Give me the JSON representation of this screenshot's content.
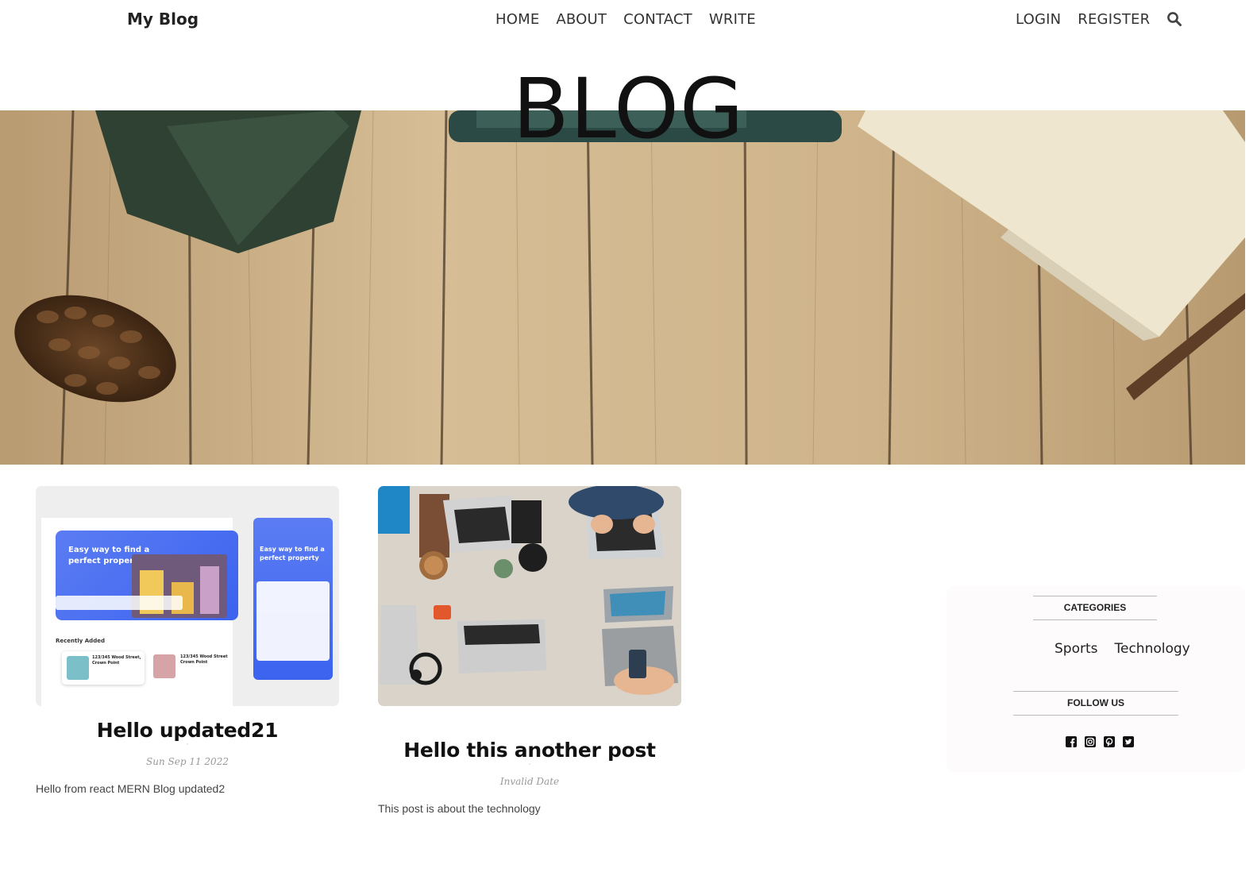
{
  "topbar": {
    "brand": "My Blog",
    "nav_center": [
      "HOME",
      "ABOUT",
      "CONTACT",
      "WRITE"
    ],
    "nav_right": [
      "LOGIN",
      "REGISTER"
    ],
    "search_icon": "search-icon"
  },
  "hero": {
    "title": "BLOG"
  },
  "posts": [
    {
      "title": "Hello updated21",
      "date": "Sun Sep 11 2022",
      "desc": "Hello from react MERN Blog updated2",
      "thumb": {
        "headline_1": "Easy way to find a",
        "headline_2": "perfect property",
        "section": "Recently Added",
        "listing_1": "123/345 Wood Street, Crown Point",
        "listing_2": "123/345 Wood Street Crown Point"
      }
    },
    {
      "title": "Hello this another post",
      "date": "Invalid Date",
      "desc": "This post is about the technology"
    }
  ],
  "sidebar": {
    "categories_title": "CATEGORIES",
    "categories": [
      "Sports",
      "Technology"
    ],
    "follow_title": "FOLLOW US",
    "social_icons": [
      "facebook-icon",
      "instagram-icon",
      "pinterest-icon",
      "twitter-icon"
    ]
  },
  "colors": {
    "thumb_blue": "#4f6df0",
    "wood": "#c9ad86"
  }
}
